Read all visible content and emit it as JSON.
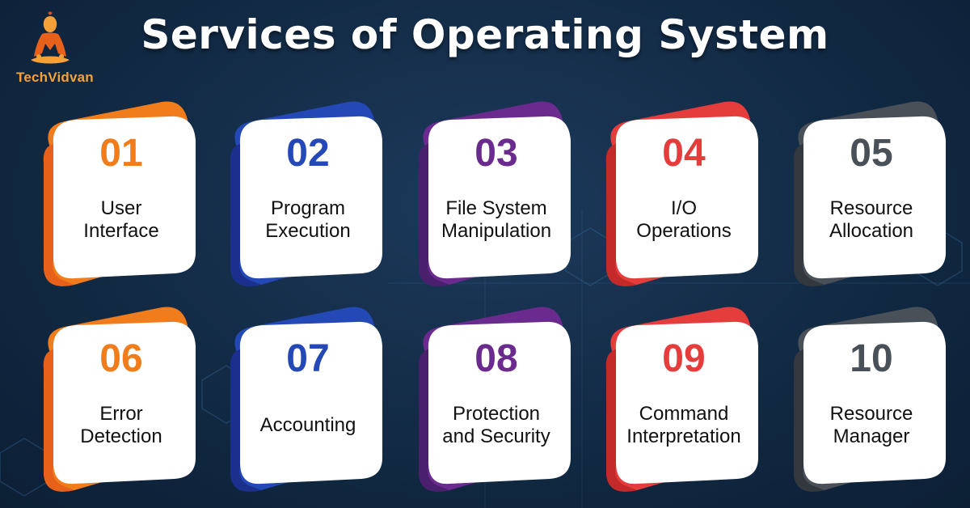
{
  "brand": {
    "name": "TechVidvan",
    "color": "#f5a13a"
  },
  "title": "Services of Operating System",
  "cards": [
    {
      "num": "01",
      "label": "User\nInterface",
      "color": "#f07c1c",
      "dark": "#e8611a"
    },
    {
      "num": "02",
      "label": "Program\nExecution",
      "color": "#2448b5",
      "dark": "#1b2f8c"
    },
    {
      "num": "03",
      "label": "File System\nManipulation",
      "color": "#6a2a8e",
      "dark": "#4a1f6e"
    },
    {
      "num": "04",
      "label": "I/O\nOperations",
      "color": "#e53c3c",
      "dark": "#c42a2a"
    },
    {
      "num": "05",
      "label": "Resource\nAllocation",
      "color": "#4a5058",
      "dark": "#33383f"
    },
    {
      "num": "06",
      "label": "Error\nDetection",
      "color": "#f07c1c",
      "dark": "#e8611a"
    },
    {
      "num": "07",
      "label": "Accounting",
      "color": "#2448b5",
      "dark": "#1b2f8c"
    },
    {
      "num": "08",
      "label": "Protection\nand Security",
      "color": "#6a2a8e",
      "dark": "#4a1f6e"
    },
    {
      "num": "09",
      "label": "Command\nInterpretation",
      "color": "#e53c3c",
      "dark": "#c42a2a"
    },
    {
      "num": "10",
      "label": "Resource\nManager",
      "color": "#4a5058",
      "dark": "#33383f"
    }
  ]
}
